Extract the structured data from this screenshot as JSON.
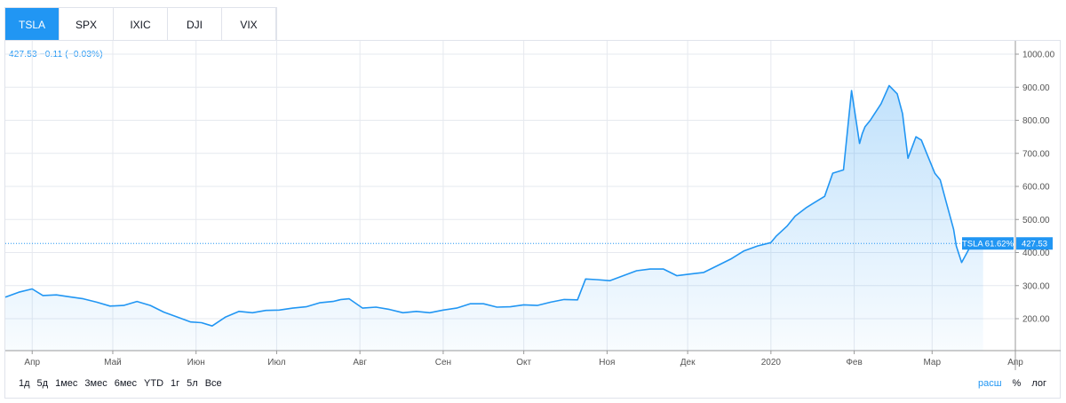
{
  "tabs": [
    {
      "label": "TSLA",
      "active": true
    },
    {
      "label": "SPX",
      "active": false
    },
    {
      "label": "IXIC",
      "active": false
    },
    {
      "label": "DJI",
      "active": false
    },
    {
      "label": "VIX",
      "active": false
    }
  ],
  "legend": {
    "text": "427.53  −0.11 (−0.03%)"
  },
  "price_label": {
    "text": "427.53",
    "series_tag": "TSLA 61.62%"
  },
  "ranges": [
    "1д",
    "5д",
    "1мес",
    "3мес",
    "6мес",
    "YTD",
    "1г",
    "5л",
    "Все"
  ],
  "scale_controls": [
    {
      "label": "расш",
      "active": true
    },
    {
      "label": "%",
      "active": false
    },
    {
      "label": "лог",
      "active": false
    }
  ],
  "colors": {
    "line": "#2196f3",
    "tab_active": "#2196f3",
    "price_tag": "#2196f3",
    "grid": "#e6e9ef"
  },
  "chart_data": {
    "type": "area",
    "series": [
      {
        "name": "TSLA",
        "x": [
          "2019-03-22",
          "2019-03-27",
          "2019-04-01",
          "2019-04-05",
          "2019-04-10",
          "2019-04-15",
          "2019-04-20",
          "2019-04-25",
          "2019-04-30",
          "2019-05-05",
          "2019-05-10",
          "2019-05-15",
          "2019-05-20",
          "2019-05-25",
          "2019-05-30",
          "2019-06-03",
          "2019-06-07",
          "2019-06-12",
          "2019-06-17",
          "2019-06-22",
          "2019-06-27",
          "2019-07-02",
          "2019-07-07",
          "2019-07-12",
          "2019-07-17",
          "2019-07-22",
          "2019-07-25",
          "2019-07-28",
          "2019-08-02",
          "2019-08-07",
          "2019-08-12",
          "2019-08-17",
          "2019-08-22",
          "2019-08-27",
          "2019-09-01",
          "2019-09-06",
          "2019-09-11",
          "2019-09-16",
          "2019-09-21",
          "2019-09-26",
          "2019-10-01",
          "2019-10-06",
          "2019-10-11",
          "2019-10-16",
          "2019-10-21",
          "2019-10-24",
          "2019-10-28",
          "2019-11-02",
          "2019-11-07",
          "2019-11-12",
          "2019-11-17",
          "2019-11-22",
          "2019-11-27",
          "2019-12-02",
          "2019-12-07",
          "2019-12-12",
          "2019-12-17",
          "2019-12-22",
          "2019-12-27",
          "2020-01-01",
          "2020-01-03",
          "2020-01-07",
          "2020-01-10",
          "2020-01-14",
          "2020-01-17",
          "2020-01-21",
          "2020-01-24",
          "2020-01-28",
          "2020-01-31",
          "2020-02-03",
          "2020-02-04",
          "2020-02-05",
          "2020-02-07",
          "2020-02-11",
          "2020-02-14",
          "2020-02-17",
          "2020-02-19",
          "2020-02-21",
          "2020-02-24",
          "2020-02-26",
          "2020-02-28",
          "2020-03-02",
          "2020-03-04",
          "2020-03-06",
          "2020-03-09",
          "2020-03-10",
          "2020-03-12",
          "2020-03-14",
          "2020-03-16",
          "2020-03-18",
          "2020-03-19",
          "2020-03-20"
        ],
        "values": [
          265,
          280,
          290,
          270,
          272,
          266,
          260,
          250,
          238,
          240,
          252,
          240,
          220,
          205,
          190,
          188,
          178,
          205,
          222,
          218,
          225,
          226,
          232,
          236,
          248,
          252,
          258,
          260,
          232,
          235,
          228,
          218,
          222,
          218,
          226,
          232,
          245,
          245,
          235,
          236,
          242,
          240,
          250,
          258,
          257,
          320,
          318,
          315,
          330,
          345,
          350,
          350,
          330,
          335,
          340,
          360,
          380,
          405,
          420,
          430,
          450,
          480,
          510,
          535,
          550,
          570,
          640,
          650,
          890,
          730,
          760,
          780,
          800,
          850,
          905,
          880,
          820,
          685,
          750,
          740,
          700,
          640,
          620,
          560,
          470,
          420,
          370,
          400,
          430,
          427.53,
          427.53,
          427.53
        ]
      }
    ],
    "x_ticks": [
      "Апр",
      "Май",
      "Июн",
      "Июл",
      "Авг",
      "Сен",
      "Окт",
      "Ноя",
      "Дек",
      "2020",
      "Фев",
      "Мар",
      "Апр"
    ],
    "y_ticks": [
      "200.00",
      "300.00",
      "400.00",
      "500.00",
      "600.00",
      "700.00",
      "800.00",
      "900.00",
      "1000.00"
    ],
    "ylim": [
      100,
      1000
    ],
    "last_value": 427.53,
    "grid": true
  }
}
